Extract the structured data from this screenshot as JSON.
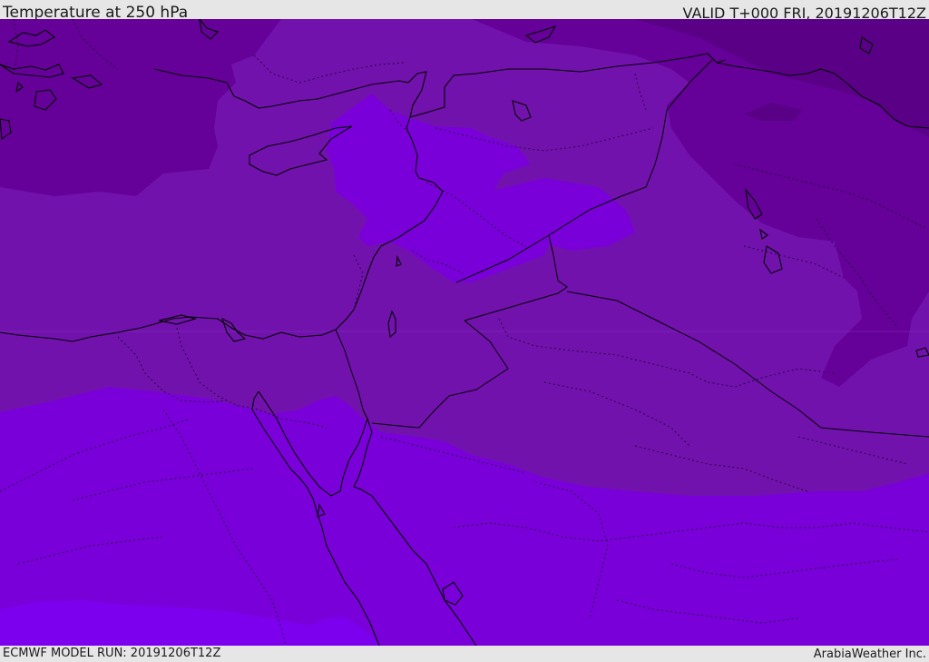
{
  "header": {
    "title": "Temperature at 250 hPa",
    "valid": "VALID T+000 FRI, 20191206T12Z"
  },
  "footer": {
    "model_run": "ECMWF MODEL RUN: 20191206T12Z",
    "credit": "ArabiaWeather Inc."
  },
  "colors": {
    "band_darkest": "#5a0087",
    "band_dark": "#650099",
    "band_mid": "#7212ad",
    "band_bright": "#7a00d9",
    "band_brightest": "#7c00ee",
    "coast": "#000000",
    "border": "#000000",
    "header_bg": "#e6e6e6"
  }
}
